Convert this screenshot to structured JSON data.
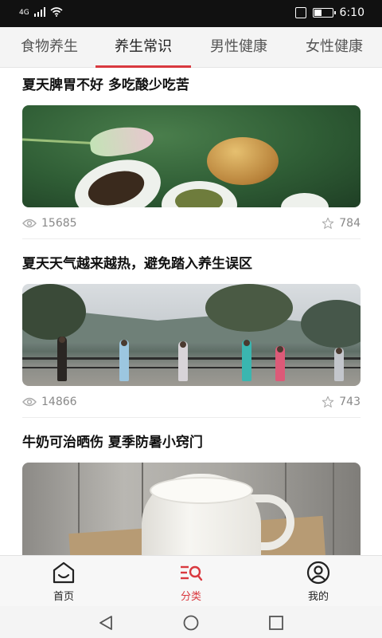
{
  "status_bar": {
    "signal_label": "4G",
    "time": "6:10",
    "battery_level": 0.45
  },
  "tabs": [
    {
      "label": "食物养生",
      "active": false
    },
    {
      "label": "养生常识",
      "active": true
    },
    {
      "label": "男性健康",
      "active": false
    },
    {
      "label": "女性健康",
      "active": false
    }
  ],
  "articles": [
    {
      "title": "夏天脾胃不好 多吃酸少吃苦",
      "views": "15685",
      "stars": "784",
      "image": "tea-on-lotus-leaf"
    },
    {
      "title": "夏天天气越来越热，避免踏入养生误区",
      "views": "14866",
      "stars": "743",
      "image": "park-morning-exercise"
    },
    {
      "title": "牛奶可治晒伤 夏季防暑小窍门",
      "image": "milk-jug-on-wood"
    }
  ],
  "bottom_nav": [
    {
      "label": "首页",
      "icon": "home-face-icon",
      "active": false
    },
    {
      "label": "分类",
      "icon": "category-search-icon",
      "active": true
    },
    {
      "label": "我的",
      "icon": "user-profile-icon",
      "active": false
    }
  ],
  "system_nav": {
    "icons": [
      "back-triangle-icon",
      "home-circle-icon",
      "recents-square-icon"
    ]
  },
  "colors": {
    "accent": "#d9393f",
    "status_bar": "#111111",
    "tab_bar": "#f4f4f4"
  }
}
